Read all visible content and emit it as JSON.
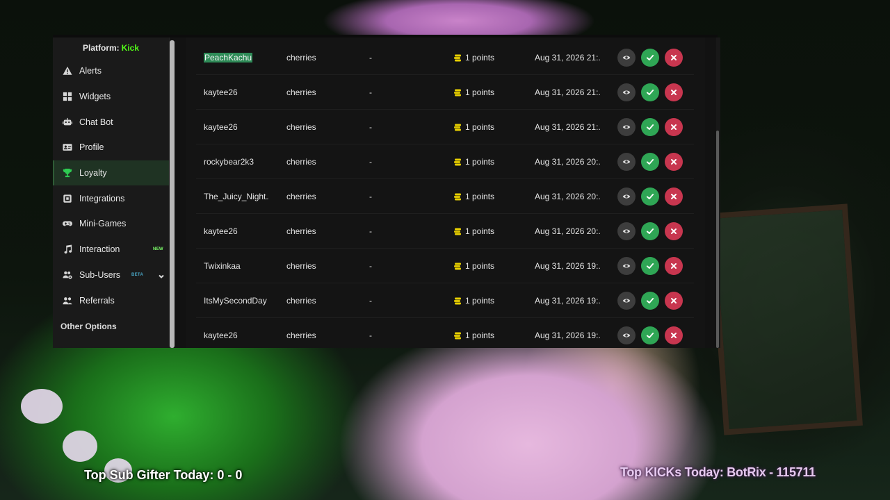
{
  "sidebar": {
    "platform_label": "Platform:",
    "platform_name": "Kick",
    "items": [
      {
        "label": "Alerts",
        "icon": "warning-icon",
        "active": false
      },
      {
        "label": "Widgets",
        "icon": "widgets-icon",
        "active": false
      },
      {
        "label": "Chat Bot",
        "icon": "robot-icon",
        "active": false
      },
      {
        "label": "Profile",
        "icon": "id-card-icon",
        "active": false
      },
      {
        "label": "Loyalty",
        "icon": "trophy-icon",
        "active": true
      },
      {
        "label": "Integrations",
        "icon": "plug-icon",
        "active": false
      },
      {
        "label": "Mini-Games",
        "icon": "gamepad-icon",
        "active": false
      },
      {
        "label": "Interaction",
        "icon": "music-note-icon",
        "active": false,
        "badge": "NEW"
      },
      {
        "label": "Sub-Users",
        "icon": "users-cog-icon",
        "active": false,
        "badge": "BETA",
        "expandable": true
      },
      {
        "label": "Referrals",
        "icon": "user-group-icon",
        "active": false
      }
    ],
    "section_heading": "Other Options"
  },
  "redemptions": [
    {
      "user": "PeachKachu",
      "reward": "cherries",
      "input": "-",
      "cost": "1 points",
      "date": "Aug 31, 2026 21:...",
      "highlighted": true
    },
    {
      "user": "kaytee26",
      "reward": "cherries",
      "input": "-",
      "cost": "1 points",
      "date": "Aug 31, 2026 21:..."
    },
    {
      "user": "kaytee26",
      "reward": "cherries",
      "input": "-",
      "cost": "1 points",
      "date": "Aug 31, 2026 21:..."
    },
    {
      "user": "rockybear2k3",
      "reward": "cherries",
      "input": "-",
      "cost": "1 points",
      "date": "Aug 31, 2026 20:..."
    },
    {
      "user": "The_Juicy_Night...",
      "reward": "cherries",
      "input": "-",
      "cost": "1 points",
      "date": "Aug 31, 2026 20:..."
    },
    {
      "user": "kaytee26",
      "reward": "cherries",
      "input": "-",
      "cost": "1 points",
      "date": "Aug 31, 2026 20:..."
    },
    {
      "user": "Twixinkaa",
      "reward": "cherries",
      "input": "-",
      "cost": "1 points",
      "date": "Aug 31, 2026 19:..."
    },
    {
      "user": "ItsMySecondDay",
      "reward": "cherries",
      "input": "-",
      "cost": "1 points",
      "date": "Aug 31, 2026 19:..."
    },
    {
      "user": "kaytee26",
      "reward": "cherries",
      "input": "-",
      "cost": "1 points",
      "date": "Aug 31, 2026 19:..."
    }
  ],
  "actions": {
    "view_icon": "eye-icon",
    "approve_icon": "check-icon",
    "reject_icon": "close-icon"
  },
  "colors": {
    "kick_green": "#53fc18",
    "approve": "#2fa655",
    "reject": "#c8364f",
    "coin": "#e8d000"
  },
  "stream_overlay": {
    "top_sub_gifter": "Top Sub Gifter Today: 0 - 0",
    "top_kicks": "Top KICKs Today: BotRix - 115711"
  }
}
